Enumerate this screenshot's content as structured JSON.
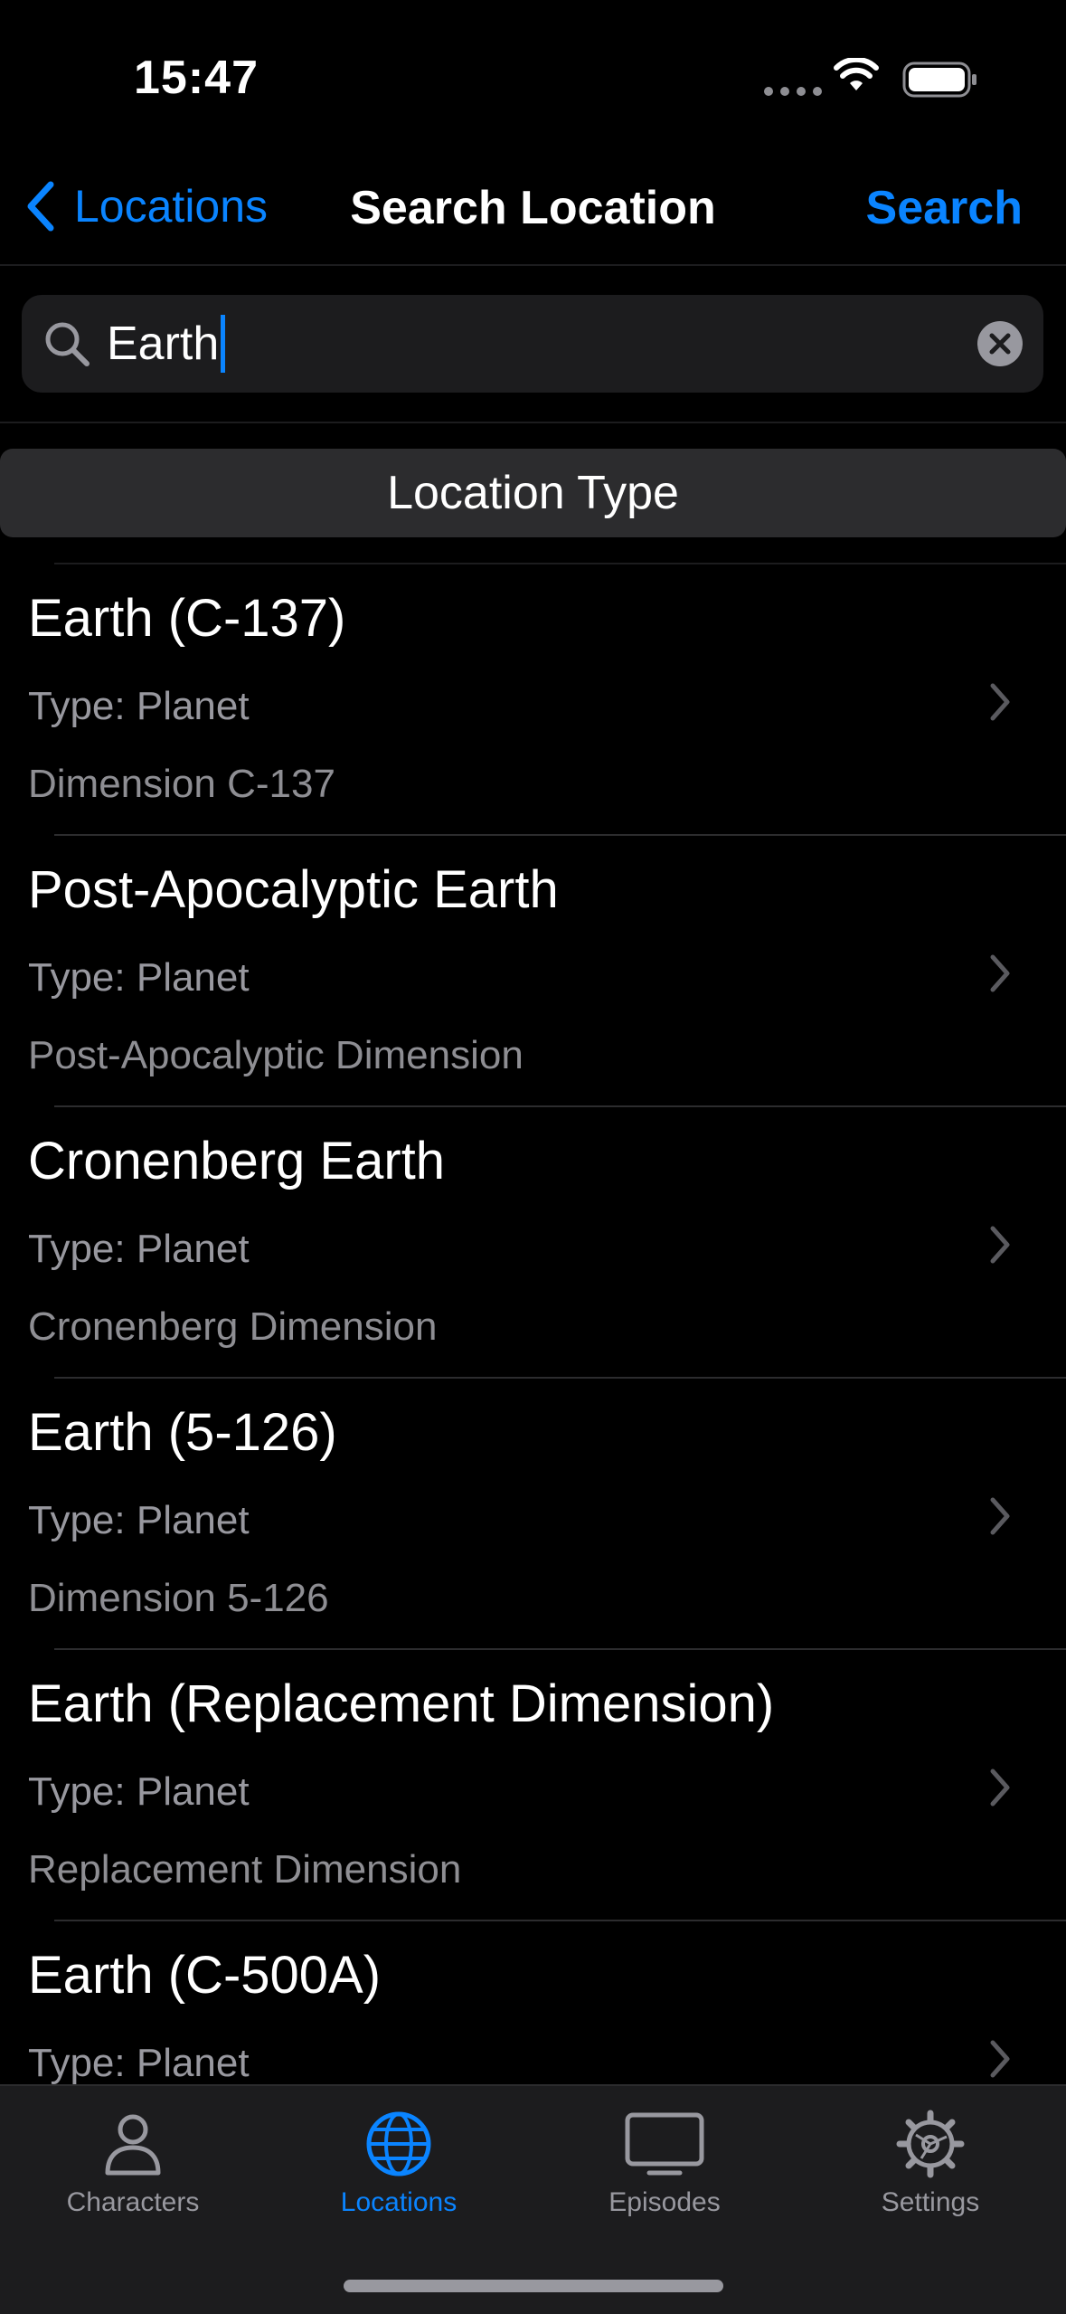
{
  "status_bar": {
    "time": "15:47"
  },
  "nav": {
    "back_label": "Locations",
    "title": "Search Location",
    "action_label": "Search"
  },
  "search": {
    "query": "Earth"
  },
  "section": {
    "header": "Location Type"
  },
  "locations": [
    {
      "name": "Earth (C-137)",
      "type": "Type: Planet",
      "dimension": "Dimension C-137"
    },
    {
      "name": "Post-Apocalyptic Earth",
      "type": "Type: Planet",
      "dimension": "Post-Apocalyptic Dimension"
    },
    {
      "name": "Cronenberg Earth",
      "type": "Type: Planet",
      "dimension": "Cronenberg Dimension"
    },
    {
      "name": "Earth (5-126)",
      "type": "Type: Planet",
      "dimension": "Dimension 5-126"
    },
    {
      "name": "Earth (Replacement Dimension)",
      "type": "Type: Planet",
      "dimension": "Replacement Dimension"
    },
    {
      "name": "Earth (C-500A)",
      "type": "Type: Planet",
      "dimension": ""
    }
  ],
  "tabs": [
    {
      "label": "Characters",
      "icon": "person-icon"
    },
    {
      "label": "Locations",
      "icon": "globe-icon",
      "active": true
    },
    {
      "label": "Episodes",
      "icon": "tv-icon"
    },
    {
      "label": "Settings",
      "icon": "gear-icon"
    }
  ],
  "colors": {
    "accent": "#0a84ff",
    "background": "#000000",
    "secondary_text": "#98989f",
    "grouped": "#1c1c1e"
  }
}
